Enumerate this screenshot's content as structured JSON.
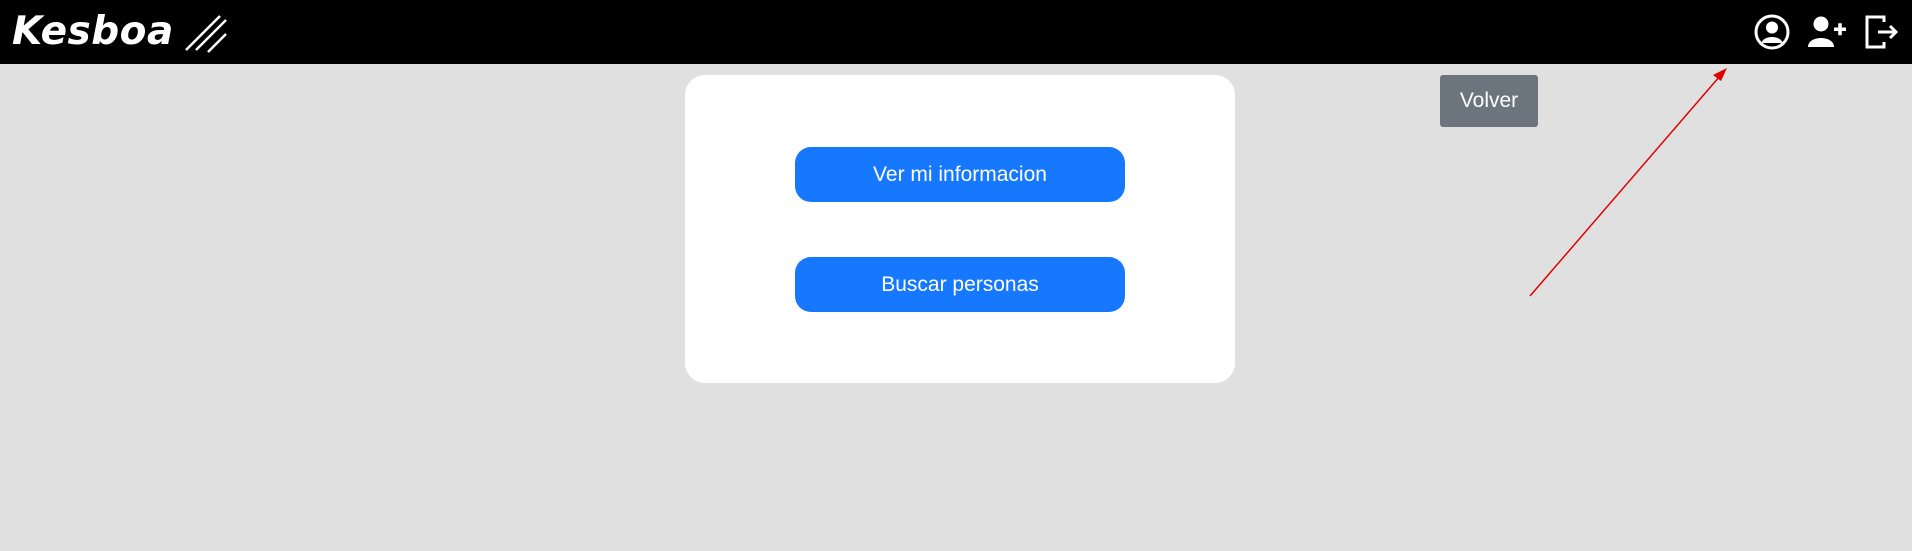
{
  "navbar": {
    "brand": "Kesboa",
    "icons": [
      {
        "name": "user-circle-icon"
      },
      {
        "name": "user-plus-icon"
      },
      {
        "name": "sign-out-icon"
      }
    ]
  },
  "card": {
    "info_button_label": "Ver mi informacion",
    "search_button_label": "Buscar personas"
  },
  "volver_label": "Volver",
  "colors": {
    "navbar_bg": "#000000",
    "page_bg": "#e0e0e0",
    "primary": "#1677ff",
    "secondary": "#6c757d",
    "annotation_arrow": "#e00000"
  }
}
